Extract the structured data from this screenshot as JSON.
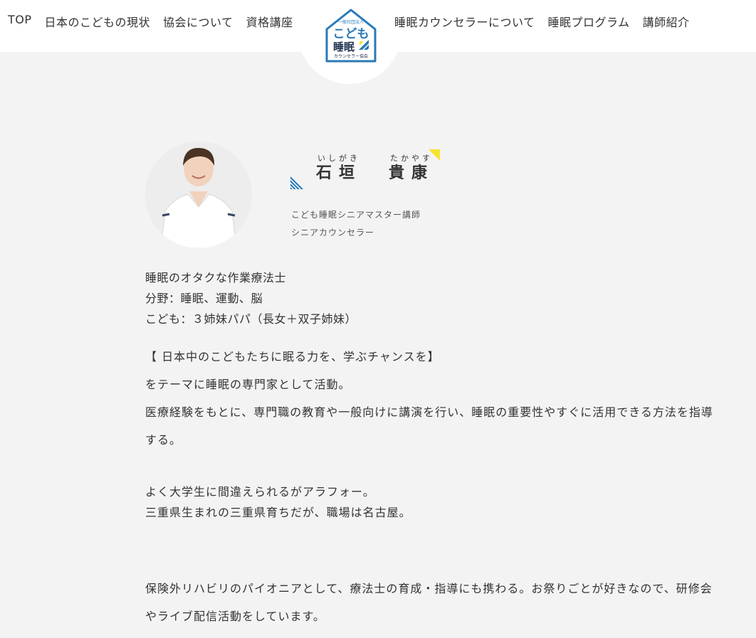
{
  "nav": {
    "left": [
      "TOP",
      "日本のこどもの現状",
      "協会について",
      "資格講座"
    ],
    "right": [
      "睡眠カウンセラーについて",
      "睡眠プログラム",
      "講師紹介"
    ]
  },
  "logo": {
    "top_text": "一般社団法人",
    "line1": "こども",
    "line2": "睡眠",
    "line3": "カウンセラー協会",
    "accent_color": "#2a79b7",
    "yellow": "#f6e42c"
  },
  "profile": {
    "family_furigana": "いしがき",
    "family_name": "石垣",
    "given_furigana": "たかやす",
    "given_name": "貴康",
    "title1": "こども睡眠シニアマスター講師",
    "title2": "シニアカウンセラー"
  },
  "summary": {
    "line1": "睡眠のオタクな作業療法士",
    "line2": "分野：睡眠、運動、脳",
    "line3": "こども：３姉妹パパ（長女＋双子姉妹）"
  },
  "bio": {
    "p1_l1": "【 日本中のこどもたちに眠る力を、学ぶチャンスを】",
    "p1_l2": "をテーマに睡眠の専門家として活動。",
    "p1_l3": "医療経験をもとに、専門職の教育や一般向けに講演を行い、睡眠の重要性やすぐに活用できる方法を指導する。",
    "p2_l1": "よく大学生に間違えられるがアラフォー。",
    "p2_l2": "三重県生まれの三重県育ちだが、職場は名古屋。",
    "p3": "保険外リハビリのパイオニアとして、療法士の育成・指導にも携わる。お祭りごとが好きなので、研修会やライブ配信活動をしています。"
  }
}
